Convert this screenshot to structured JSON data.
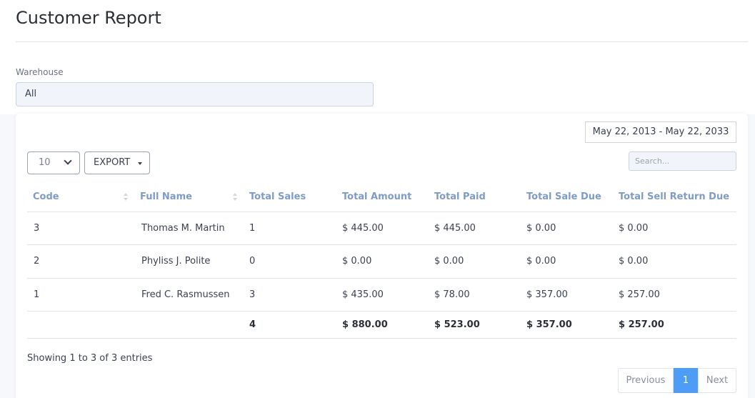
{
  "page": {
    "title": "Customer Report"
  },
  "filters": {
    "warehouse_label": "Warehouse",
    "warehouse_value": "All",
    "date_range": "May 22, 2013 - May 22, 2033"
  },
  "toolbar": {
    "page_length": "10",
    "export_label": "EXPORT",
    "search_placeholder": "Search..."
  },
  "table": {
    "headers": {
      "code": "Code",
      "full_name": "Full Name",
      "total_sales": "Total Sales",
      "total_amount": "Total Amount",
      "total_paid": "Total Paid",
      "total_sale_due": "Total Sale Due",
      "total_sell_return_due": "Total Sell Return Due"
    },
    "rows": [
      {
        "code": "3",
        "full_name": "Thomas M. Martin",
        "total_sales": "1",
        "total_amount": "$ 445.00",
        "total_paid": "$ 445.00",
        "total_sale_due": "$ 0.00",
        "total_sell_return_due": "$ 0.00"
      },
      {
        "code": "2",
        "full_name": "Phyliss J. Polite",
        "total_sales": "0",
        "total_amount": "$ 0.00",
        "total_paid": "$ 0.00",
        "total_sale_due": "$ 0.00",
        "total_sell_return_due": "$ 0.00"
      },
      {
        "code": "1",
        "full_name": "Fred C. Rasmussen",
        "total_sales": "3",
        "total_amount": "$ 435.00",
        "total_paid": "$ 78.00",
        "total_sale_due": "$ 357.00",
        "total_sell_return_due": "$ 257.00"
      }
    ],
    "totals": {
      "total_sales": "4",
      "total_amount": "$ 880.00",
      "total_paid": "$ 523.00",
      "total_sale_due": "$ 357.00",
      "total_sell_return_due": "$ 257.00"
    }
  },
  "footer": {
    "showing": "Showing 1 to 3 of 3 entries",
    "pagination": {
      "previous": "Previous",
      "current": "1",
      "next": "Next"
    }
  },
  "colors": {
    "accent": "#4d9cf6",
    "header_text": "#7e9cc5"
  }
}
